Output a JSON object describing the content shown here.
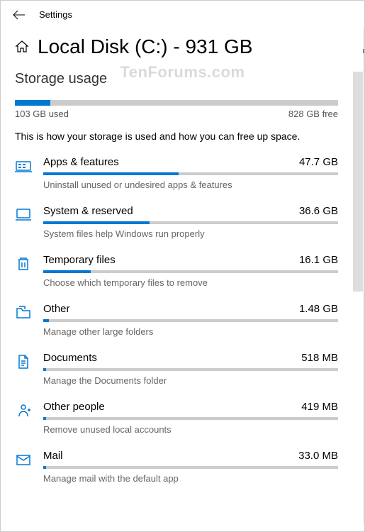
{
  "header": {
    "window_title": "Settings"
  },
  "page": {
    "title": "Local Disk (C:) - 931 GB",
    "section": "Storage usage",
    "description": "This is how your storage is used and how you can free up space."
  },
  "total": {
    "used_label": "103 GB used",
    "free_label": "828 GB free",
    "used_percent": 11
  },
  "categories": [
    {
      "name": "Apps & features",
      "size": "47.7 GB",
      "hint": "Uninstall unused or undesired apps & features",
      "percent": 46,
      "icon": "apps"
    },
    {
      "name": "System & reserved",
      "size": "36.6 GB",
      "hint": "System files help Windows run properly",
      "percent": 36,
      "icon": "laptop"
    },
    {
      "name": "Temporary files",
      "size": "16.1 GB",
      "hint": "Choose which temporary files to remove",
      "percent": 16,
      "icon": "trash"
    },
    {
      "name": "Other",
      "size": "1.48 GB",
      "hint": "Manage other large folders",
      "percent": 2,
      "icon": "folder"
    },
    {
      "name": "Documents",
      "size": "518 MB",
      "hint": "Manage the Documents folder",
      "percent": 1,
      "icon": "document"
    },
    {
      "name": "Other people",
      "size": "419 MB",
      "hint": "Remove unused local accounts",
      "percent": 1,
      "icon": "people"
    },
    {
      "name": "Mail",
      "size": "33.0 MB",
      "hint": "Manage mail with the default app",
      "percent": 1,
      "icon": "mail"
    }
  ],
  "watermark": "TenForums.com"
}
